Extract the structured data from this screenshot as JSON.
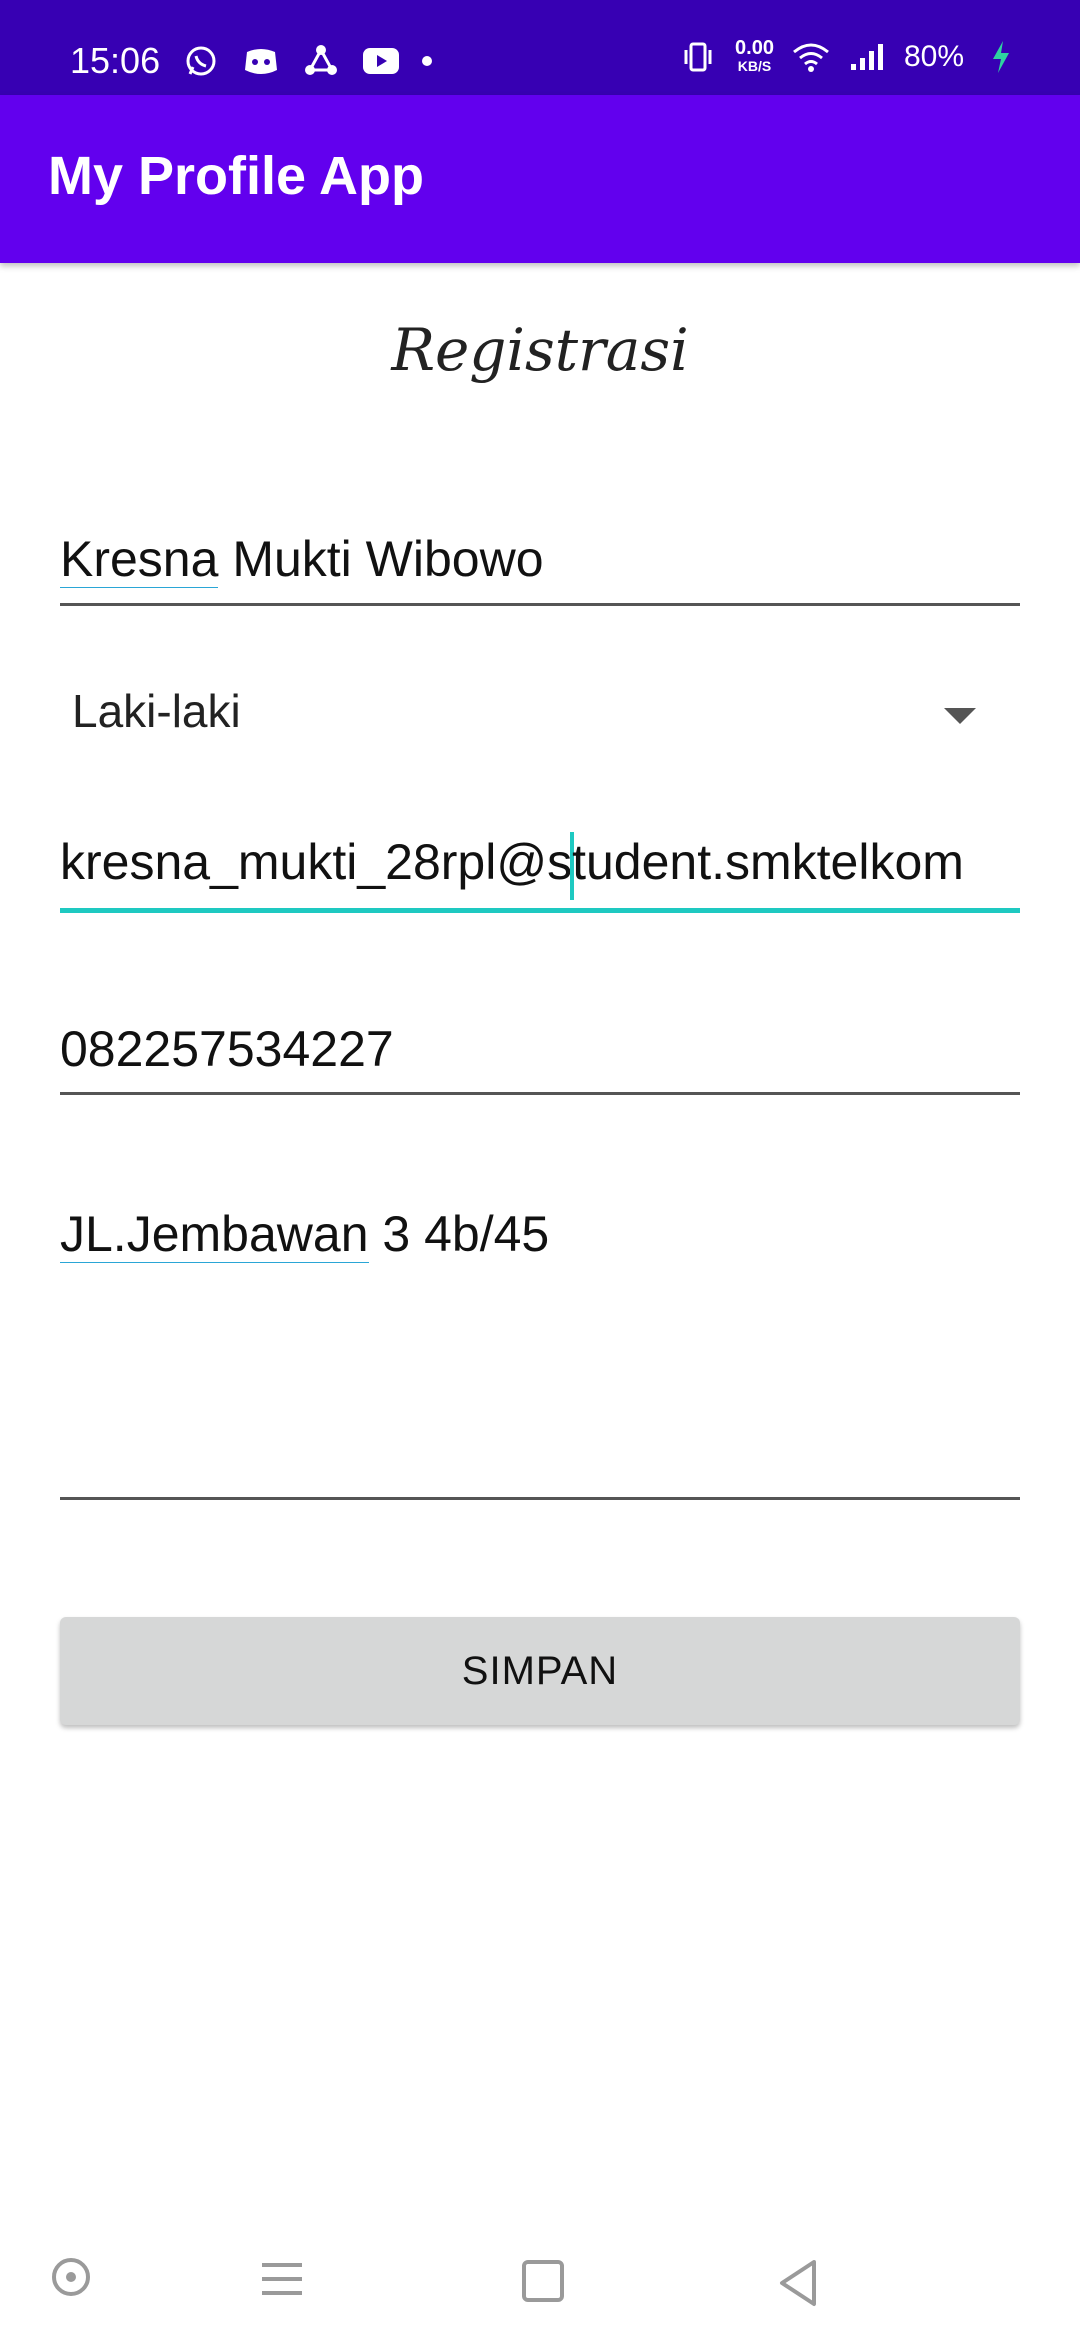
{
  "status_bar": {
    "time": "15:06",
    "notification_icons": [
      "whatsapp-icon",
      "discord-icon",
      "share-icon",
      "youtube-icon",
      "dot-icon"
    ],
    "net_speed_value": "0.00",
    "net_speed_unit": "KB/S",
    "battery": "80%"
  },
  "app_bar": {
    "title": "My Profile App"
  },
  "form": {
    "heading": "Registrasi",
    "name_first": "Kresna",
    "name_rest": " Mukti Wibowo",
    "gender": "Laki-laki",
    "email_before_cursor": "kresna_mukti_28rpl@s",
    "email_after_cursor": "tudent.smktelkom",
    "phone": "082257534227",
    "address_first": "JL.Jembawan",
    "address_rest": " 3 4b/45",
    "save_label": "SIMPAN"
  },
  "colors": {
    "status_bar": "#3700B3",
    "app_bar": "#6200EE",
    "focus_accent": "#1ec9c1",
    "button": "#d6d7d7"
  }
}
